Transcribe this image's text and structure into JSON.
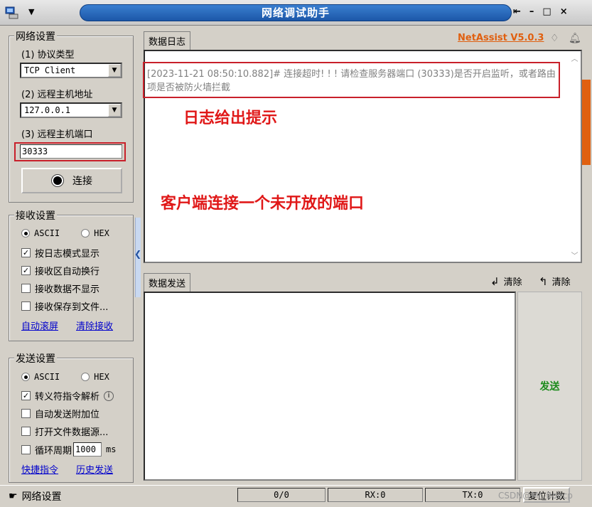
{
  "window": {
    "title": "网络调试助手",
    "minimize": "–",
    "maximize": "□",
    "close": "×"
  },
  "network": {
    "group_title": "网络设置",
    "protocol_label": "(1) 协议类型",
    "protocol_value": "TCP Client",
    "host_label": "(2) 远程主机地址",
    "host_value": "127.0.0.1",
    "port_label": "(3) 远程主机端口",
    "port_value": "30333",
    "connect_label": "连接"
  },
  "receive": {
    "group_title": "接收设置",
    "ascii": "ASCII",
    "hex": "HEX",
    "options": [
      {
        "label": "按日志模式显示",
        "checked": true
      },
      {
        "label": "接收区自动换行",
        "checked": true
      },
      {
        "label": "接收数据不显示",
        "checked": false
      },
      {
        "label": "接收保存到文件...",
        "checked": false
      }
    ],
    "auto_scroll": "自动滚屏",
    "clear_receive": "清除接收"
  },
  "send": {
    "group_title": "发送设置",
    "ascii": "ASCII",
    "hex": "HEX",
    "options": [
      {
        "label": "转义符指令解析",
        "checked": true
      },
      {
        "label": "自动发送附加位",
        "checked": false
      },
      {
        "label": "打开文件数据源...",
        "checked": false
      }
    ],
    "loop_label": "循环周期",
    "loop_value": "1000",
    "loop_unit": "ms",
    "shortcut": "快捷指令",
    "history": "历史发送"
  },
  "log": {
    "tab": "数据日志",
    "brand": "NetAssist V5.0.3",
    "entry": "[2023-11-21 08:50:10.882]# 连接超时! ! ! 请检查服务器端口 (30333)是否开启监听，或者路由项是否被防火墙拦截"
  },
  "annotations": {
    "log_hint": "日志给出提示",
    "client_note": "客户端连接一个未开放的端口"
  },
  "send_area": {
    "tab": "数据发送",
    "clear1": "清除",
    "clear2": "清除",
    "send_button": "发送"
  },
  "status": {
    "label": "网络设置",
    "counter": "0/0",
    "rx": "RX:0",
    "tx": "TX:0",
    "reset": "复位计数",
    "watermark": "CSDN@Mr_Bobcp"
  },
  "colors": {
    "accent_red": "#e01818",
    "brand_orange": "#e06010",
    "send_green": "#1a8a1a",
    "link_blue": "#0000cc"
  }
}
